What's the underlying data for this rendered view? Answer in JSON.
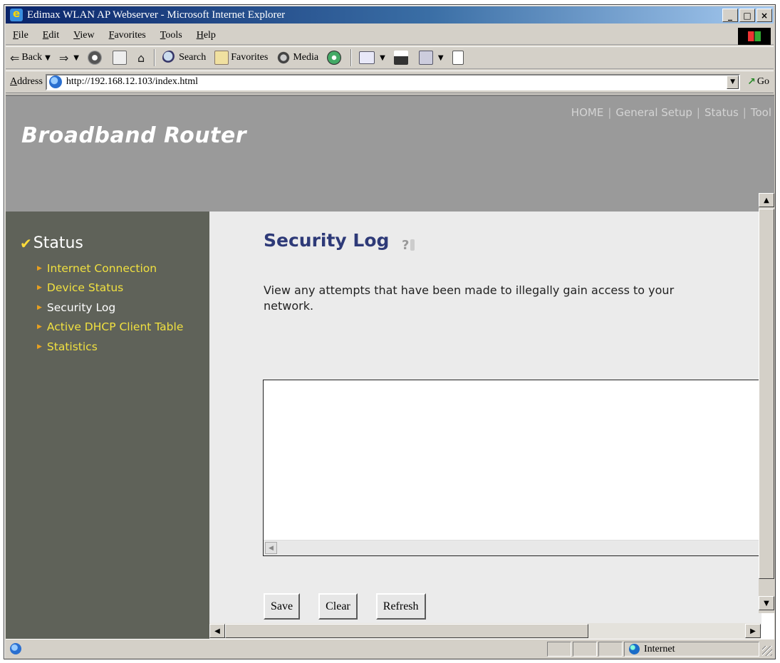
{
  "window": {
    "title": "Edimax WLAN AP Webserver - Microsoft Internet Explorer",
    "min_label": "_",
    "max_label": "□",
    "close_label": "×"
  },
  "menubar": {
    "items": [
      "File",
      "Edit",
      "View",
      "Favorites",
      "Tools",
      "Help"
    ]
  },
  "toolbar": {
    "back_label": "Back",
    "search_label": "Search",
    "favorites_label": "Favorites",
    "media_label": "Media"
  },
  "address": {
    "label": "Address",
    "url": "http://192.168.12.103/index.html",
    "go_label": "Go"
  },
  "page": {
    "brand": "Broadband Router",
    "topnav": [
      "HOME",
      "General Setup",
      "Status",
      "Tool"
    ],
    "sidebar": {
      "title": "Status",
      "items": [
        {
          "label": "Internet Connection",
          "active": false
        },
        {
          "label": "Device Status",
          "active": false
        },
        {
          "label": "Security Log",
          "active": true
        },
        {
          "label": "Active DHCP Client Table",
          "active": false
        },
        {
          "label": "Statistics",
          "active": false
        }
      ]
    },
    "title": "Security Log",
    "description": "View any attempts that have been made to illegally gain access to your network.",
    "log_content": "",
    "buttons": {
      "save": "Save",
      "clear": "Clear",
      "refresh": "Refresh"
    }
  },
  "statusbar": {
    "zone": "Internet"
  },
  "colors": {
    "banner": "#9a9a9a",
    "sidebar": "#5f6259",
    "sidebar_link": "#f0e040",
    "title": "#2e3a78",
    "titlebar_start": "#0a246a"
  }
}
